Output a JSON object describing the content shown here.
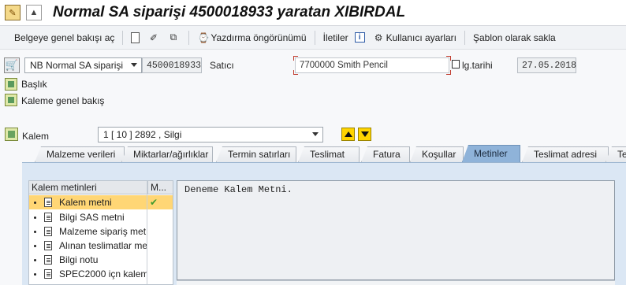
{
  "title": "Normal SA siparişi 4500018933 yaratan XIBIRDAL",
  "toolbar": {
    "overview_label": "Belgeye genel bakışı aç",
    "print_preview_label": "Yazdırma öngörünümü",
    "messages_label": "İletiler",
    "user_settings_label": "Kullanıcı ayarları",
    "save_template_label": "Şablon olarak sakla"
  },
  "header": {
    "order_type": "NB Normal SA siparişi",
    "po_number": "4500018933",
    "vendor_label": "Satıcı",
    "vendor_value": "7700000 Smith Pencil",
    "doc_date_label": "lg.tarihi",
    "doc_date_value": "27.05.2018"
  },
  "nav": {
    "header_label": "Başlık",
    "item_overview_label": "Kaleme genel bakış"
  },
  "item": {
    "label": "Kalem",
    "selected": "1 [ 10 ] 2892 , Silgi"
  },
  "tabs": [
    "Malzeme verileri",
    "Miktarlar/ağırlıklar",
    "Termin satırları",
    "Teslimat",
    "Fatura",
    "Koşullar",
    "Metinler",
    "Teslimat adresi",
    "Te"
  ],
  "active_tab": "Metinler",
  "texts_list": {
    "column1": "Kalem metinleri",
    "column2": "M...",
    "rows": [
      "Kalem metni",
      "Bilgi SAS metni",
      "Malzeme sipariş met",
      "Alınan teslimatlar me",
      "Bilgi notu",
      "SPEC2000 içn kalem"
    ],
    "selected_index": 0,
    "selected_check": "✔"
  },
  "editor": {
    "text": "Deneme Kalem Metni."
  },
  "colors": {
    "active_tab": "#8fb3d9",
    "panel_bg": "#dbe7f4",
    "selected_row": "#ffd675",
    "check": "#3d9a2d",
    "nav_arrows": "#ffd400"
  }
}
